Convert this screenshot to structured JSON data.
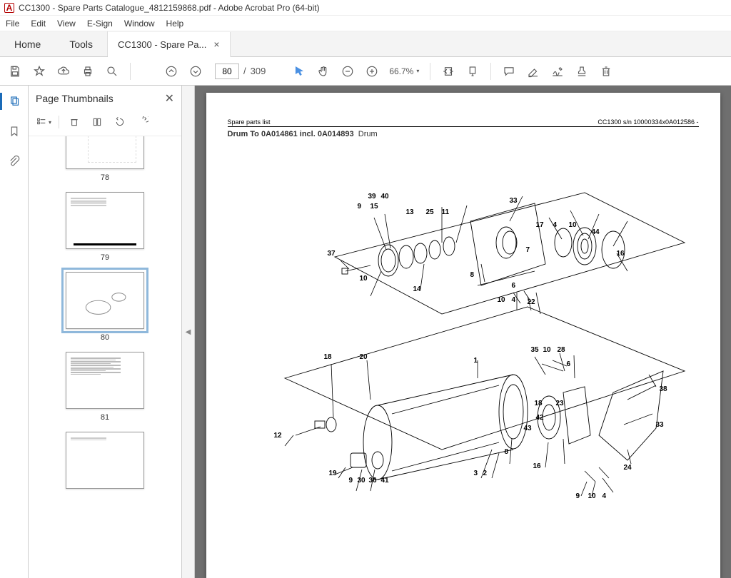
{
  "window": {
    "title": "CC1300 - Spare Parts Catalogue_4812159868.pdf - Adobe Acrobat Pro (64-bit)",
    "pdf_badge": "A"
  },
  "menu": {
    "file": "File",
    "edit": "Edit",
    "view": "View",
    "esign": "E-Sign",
    "window": "Window",
    "help": "Help"
  },
  "tabs": {
    "home": "Home",
    "tools": "Tools",
    "doc_label": "CC1300 - Spare Pa...",
    "doc_close": "×"
  },
  "toolbar": {
    "page_current": "80",
    "page_sep": "/",
    "page_total": "309",
    "zoom_pct": "66.7%",
    "zoom_caret": "▾"
  },
  "sidepanel": {
    "title": "Page Thumbnails",
    "close": "✕"
  },
  "thumbnails": [
    {
      "label": "78",
      "selected": false,
      "partial": true
    },
    {
      "label": "79",
      "selected": false
    },
    {
      "label": "80",
      "selected": true
    },
    {
      "label": "81",
      "selected": false
    },
    {
      "label": "",
      "selected": false,
      "partial_bottom": true
    }
  ],
  "collapse_arrow": "◀",
  "document": {
    "header_left": "Spare parts list",
    "header_right": "CC1300 s/n 10000334x0A012586 -",
    "title_bold": "Drum To 0A014861 incl. 0A014893",
    "title_rest": "Drum",
    "callouts": {
      "c1": "39",
      "c2": "40",
      "c3": "9",
      "c4": "15",
      "c5": "13",
      "c6": "25",
      "c7": "11",
      "c8": "33",
      "c9": "37",
      "c10": "10",
      "c11": "14",
      "c12": "8",
      "c13": "7",
      "c14": "17",
      "c15": "4",
      "c16": "10",
      "c17": "44",
      "c18": "16",
      "c19": "6",
      "c20": "10",
      "c21": "4",
      "c22": "22",
      "c23": "18",
      "c24": "20",
      "c25": "1",
      "c26": "35",
      "c27": "10",
      "c28": "28",
      "c29": "6",
      "c30": "12",
      "c31": "19",
      "c32": "9",
      "c33": "30",
      "c34": "36",
      "c35": "41",
      "c36": "8",
      "c37": "18",
      "c38": "23",
      "c39": "38",
      "c40": "33",
      "c41": "43",
      "c42": "42",
      "c43": "3",
      "c44": "2",
      "c45": "16",
      "c46": "24",
      "c47": "9",
      "c48": "10",
      "c49": "4"
    }
  }
}
